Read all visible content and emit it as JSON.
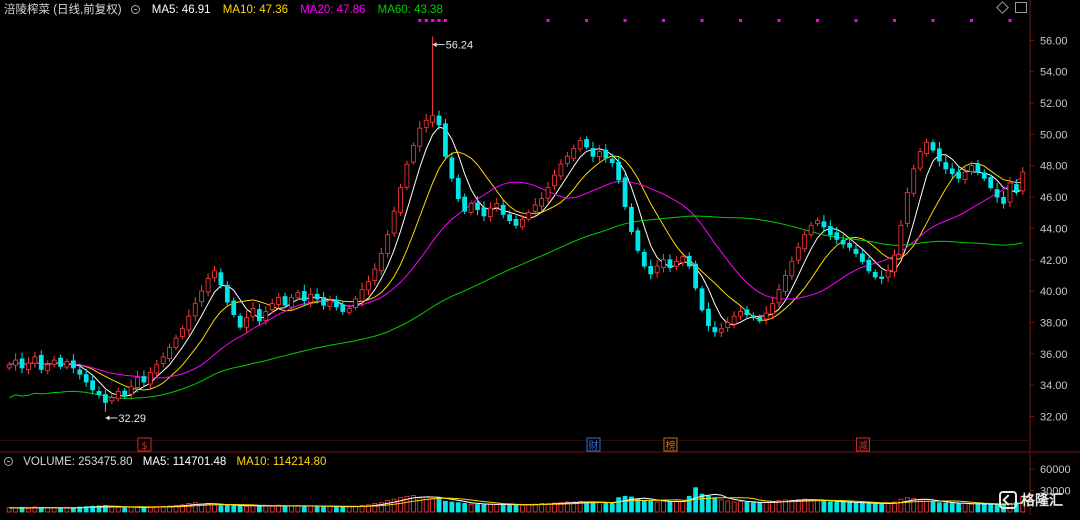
{
  "header": {
    "stock": "涪陵榨菜 (日线,前复权)",
    "ma5": "MA5: 46.91",
    "ma10": "MA10: 47.36",
    "ma20": "MA20: 47.86",
    "ma60": "MA60: 43.38"
  },
  "volume_header": {
    "volume": "VOLUME: 253475.80",
    "ma5": "MA5: 114701.48",
    "ma10": "MA10: 114214.80"
  },
  "watermark": "格隆汇",
  "colors": {
    "up": "#ff3b3b",
    "down": "#00e5e5",
    "ma5": "#ffffff",
    "ma10": "#ffd700",
    "ma20": "#ff00ff",
    "ma60": "#00d000",
    "axis_text": "#c8c8c8",
    "event_marker": "#ff00ff",
    "grid_line": "#7a1010"
  },
  "chart_data": {
    "type": "candlestick",
    "price_axis": {
      "ticks": [
        "56.00",
        "54.00",
        "52.00",
        "50.00",
        "48.00",
        "46.00",
        "44.00",
        "42.00",
        "40.00",
        "38.00",
        "36.00",
        "34.00",
        "32.00"
      ],
      "ylim": [
        30.5,
        57.3
      ]
    },
    "volume_axis": {
      "ticks": [
        "60000",
        "30000"
      ],
      "ylim": [
        0,
        70000
      ]
    },
    "annotations": [
      {
        "text": "56.24",
        "kind": "high",
        "day": 66,
        "price": 56.24
      },
      {
        "text": "32.29",
        "kind": "low",
        "day": 15,
        "price": 32.29
      }
    ],
    "event_markers": [
      {
        "text": "$",
        "day": 21
      },
      {
        "text": "财",
        "day": 91
      },
      {
        "text": "榜",
        "day": 103
      },
      {
        "text": "减",
        "day": 133
      }
    ],
    "closes": [
      35.3,
      35.6,
      35.1,
      35.4,
      35.8,
      35.0,
      35.3,
      35.6,
      35.2,
      35.5,
      35.1,
      34.7,
      34.2,
      33.7,
      33.4,
      32.9,
      33.2,
      33.6,
      33.3,
      33.9,
      34.5,
      34.2,
      34.8,
      35.3,
      35.8,
      36.4,
      37.0,
      37.6,
      38.4,
      39.2,
      40.0,
      40.8,
      41.3,
      40.4,
      39.3,
      38.5,
      37.7,
      38.3,
      38.9,
      38.1,
      38.7,
      39.2,
      39.6,
      39.1,
      39.6,
      39.9,
      39.4,
      39.8,
      39.5,
      39.1,
      39.4,
      39.0,
      38.7,
      38.9,
      39.5,
      40.1,
      40.6,
      41.4,
      42.4,
      43.6,
      45.1,
      46.6,
      48.1,
      49.3,
      50.4,
      50.9,
      51.2,
      50.6,
      48.6,
      47.2,
      45.9,
      45.1,
      45.6,
      45.2,
      44.8,
      45.3,
      45.6,
      44.9,
      44.5,
      44.2,
      44.6,
      45.0,
      45.5,
      45.9,
      46.6,
      47.4,
      48.1,
      48.6,
      49.1,
      49.6,
      49.2,
      48.6,
      48.9,
      48.5,
      48.2,
      47.1,
      45.4,
      43.8,
      42.6,
      41.6,
      41.1,
      41.6,
      42.0,
      41.5,
      41.9,
      42.2,
      41.6,
      40.2,
      38.8,
      37.8,
      37.4,
      37.6,
      38.0,
      38.4,
      38.7,
      38.5,
      38.3,
      38.1,
      38.6,
      39.2,
      40.1,
      41.0,
      41.9,
      42.8,
      43.6,
      44.2,
      44.5,
      44.1,
      43.6,
      43.3,
      43.0,
      42.8,
      42.4,
      41.9,
      41.3,
      40.9,
      40.8,
      41.3,
      42.3,
      44.2,
      46.3,
      47.8,
      48.9,
      49.5,
      49.0,
      48.3,
      47.8,
      47.5,
      47.2,
      47.6,
      48.0,
      47.6,
      47.2,
      46.6,
      46.0,
      45.6,
      46.9,
      46.4,
      47.6
    ],
    "volumes": [
      6000,
      5500,
      6500,
      5000,
      7000,
      6000,
      5500,
      6000,
      5000,
      6500,
      6000,
      7000,
      7500,
      8000,
      8500,
      9000,
      7000,
      6500,
      6000,
      6500,
      7000,
      6500,
      7000,
      7500,
      8000,
      8500,
      9000,
      10000,
      12000,
      13000,
      11000,
      12000,
      10000,
      9000,
      9500,
      9000,
      8500,
      8000,
      9000,
      8500,
      9000,
      8000,
      9500,
      8000,
      8500,
      9000,
      8000,
      8500,
      8000,
      7500,
      8000,
      7500,
      7000,
      7500,
      8000,
      9000,
      10000,
      12000,
      13000,
      16000,
      18000,
      20000,
      22000,
      23000,
      20000,
      21000,
      19000,
      20000,
      15000,
      14000,
      13000,
      12000,
      11000,
      10500,
      10000,
      11000,
      10500,
      11000,
      10000,
      9500,
      10000,
      10500,
      11000,
      12000,
      11500,
      12500,
      13000,
      14000,
      14000,
      15000,
      14000,
      13000,
      13500,
      12500,
      12000,
      20000,
      22000,
      21000,
      18000,
      16000,
      15000,
      14000,
      15500,
      14000,
      15000,
      14500,
      22000,
      34000,
      25000,
      22000,
      20000,
      17000,
      15500,
      14000,
      14500,
      13500,
      13000,
      12500,
      13500,
      14500,
      16000,
      17000,
      16500,
      17500,
      18000,
      17000,
      16000,
      15000,
      14500,
      14000,
      13500,
      13000,
      12500,
      13000,
      12000,
      11500,
      11000,
      12000,
      14000,
      18000,
      20000,
      19000,
      17000,
      15000,
      14000,
      13000,
      12500,
      12000,
      11500,
      12000,
      11000,
      11500,
      11000,
      10500,
      10000,
      11000,
      12000,
      13000,
      22000
    ]
  }
}
